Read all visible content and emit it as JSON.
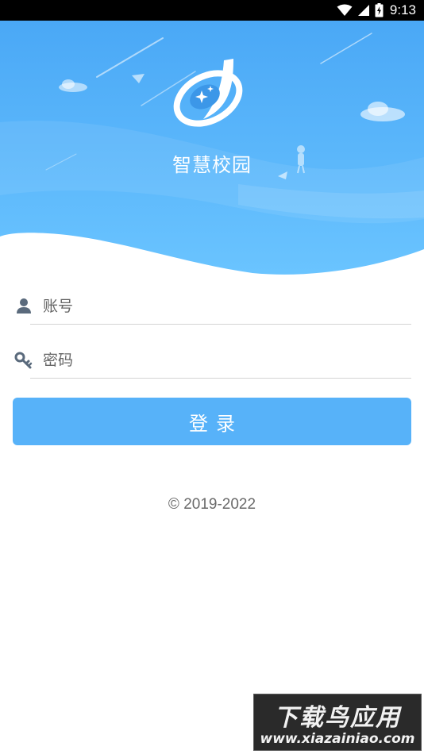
{
  "status_bar": {
    "time": "9:13"
  },
  "app": {
    "title": "智慧校园"
  },
  "login_form": {
    "account_placeholder": "账号",
    "password_placeholder": "密码",
    "login_label": "登录"
  },
  "footer": {
    "copyright": "© 2019-2022"
  },
  "watermark": {
    "line1": "下载鸟应用",
    "line2": "www.xiazainiao.com"
  },
  "colors": {
    "accent": "#57b2f9",
    "hero_top": "#4aa8f6",
    "hero_bottom": "#66c2ff"
  },
  "icons": {
    "wifi": "wifi-icon",
    "signal": "signal-icon",
    "battery": "battery-icon",
    "logo": "campus-logo-icon",
    "user": "user-icon",
    "key": "key-icon"
  }
}
